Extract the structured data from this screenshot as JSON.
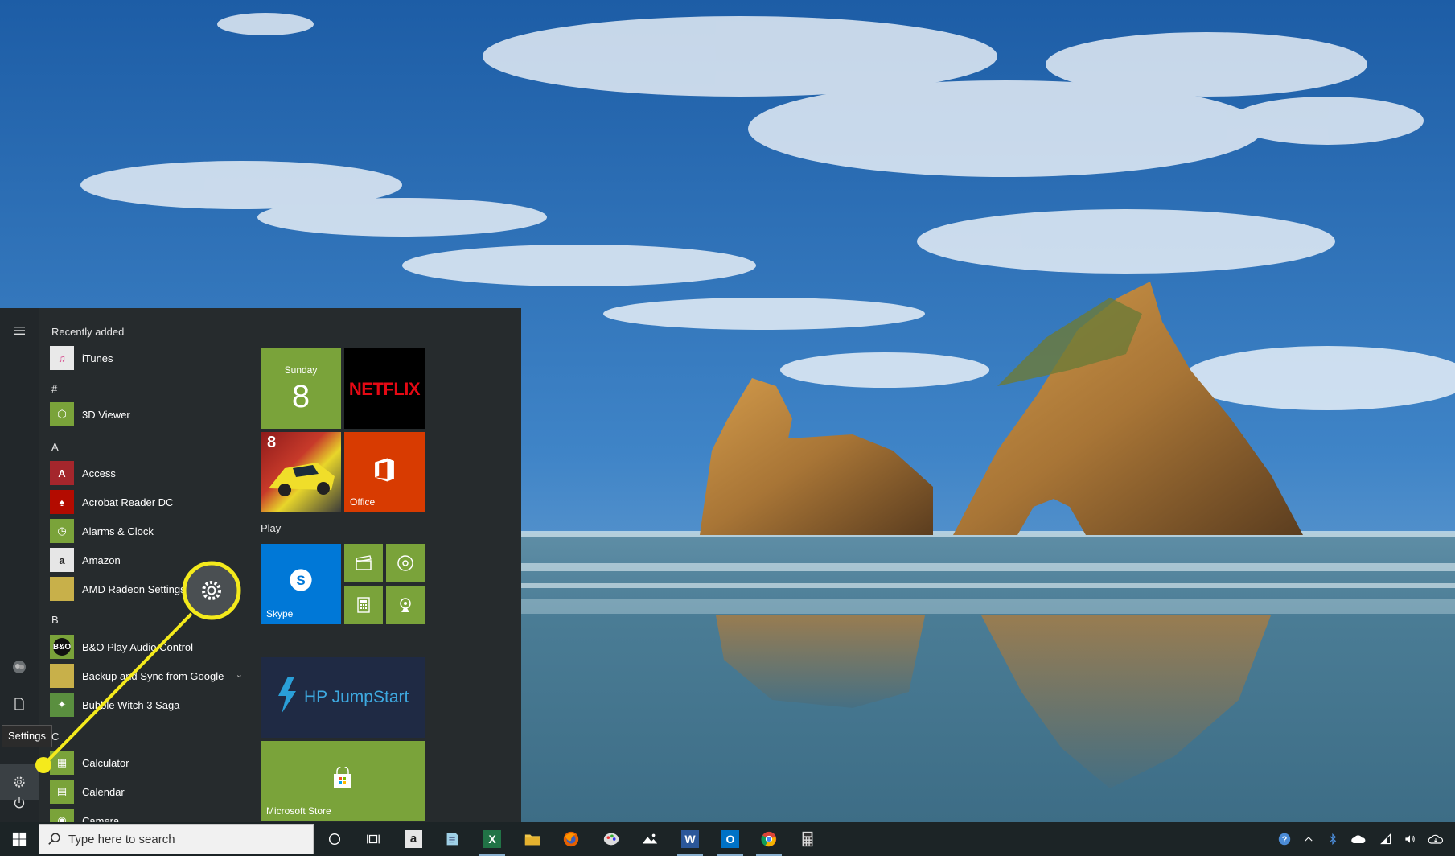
{
  "start_menu": {
    "rail": {
      "settings_tooltip": "Settings"
    },
    "applist": {
      "sections": [
        {
          "header": "Recently added",
          "items": [
            {
              "label": "iTunes",
              "icon": "itunes-icon"
            }
          ]
        },
        {
          "header": "#",
          "items": [
            {
              "label": "3D Viewer",
              "icon": "3d-viewer-icon"
            }
          ]
        },
        {
          "header": "A",
          "items": [
            {
              "label": "Access",
              "icon": "access-icon"
            },
            {
              "label": "Acrobat Reader DC",
              "icon": "acrobat-icon"
            },
            {
              "label": "Alarms & Clock",
              "icon": "alarm-clock-icon"
            },
            {
              "label": "Amazon",
              "icon": "amazon-icon"
            },
            {
              "label": "AMD Radeon Settings",
              "icon": "folder-icon"
            }
          ]
        },
        {
          "header": "B",
          "items": [
            {
              "label": "B&O Play Audio Control",
              "icon": "bo-play-icon"
            },
            {
              "label": "Backup and Sync from Google",
              "icon": "folder-icon"
            },
            {
              "label": "Bubble Witch 3 Saga",
              "icon": "bubble-witch-icon"
            }
          ]
        },
        {
          "header": "C",
          "items": [
            {
              "label": "Calculator",
              "icon": "calculator-icon"
            },
            {
              "label": "Calendar",
              "icon": "calendar-icon"
            },
            {
              "label": "Camera",
              "icon": "camera-icon"
            }
          ]
        }
      ]
    },
    "tiles": {
      "calendar": {
        "day": "Sunday",
        "date": "8"
      },
      "netflix": {
        "label": "NETFLIX"
      },
      "asphalt": {
        "badge": "8"
      },
      "office": {
        "label": "Office"
      },
      "play_group": "Play",
      "skype": {
        "label": "Skype"
      },
      "hp": {
        "label": "HP JumpStart"
      },
      "store": {
        "label": "Microsoft Store"
      }
    }
  },
  "taskbar": {
    "search_placeholder": "Type here to search",
    "pinned": [
      "cortana-icon",
      "task-view-icon",
      "amazon-icon",
      "notepad-icon",
      "excel-icon",
      "file-explorer-icon",
      "firefox-icon",
      "paint-icon",
      "photos-icon",
      "word-icon",
      "outlook-icon",
      "chrome-icon",
      "calculator-icon"
    ],
    "tray": [
      "help-icon",
      "chevron-up-icon",
      "bluetooth-icon",
      "onedrive-icon",
      "wifi-icon",
      "volume-icon",
      "cloud-icon"
    ]
  },
  "colors": {
    "accent_green": "#7aa33a",
    "callout_yellow": "#f4ea1c",
    "menu_bg": "#262b2d",
    "taskbar_bg": "#1c2426"
  }
}
